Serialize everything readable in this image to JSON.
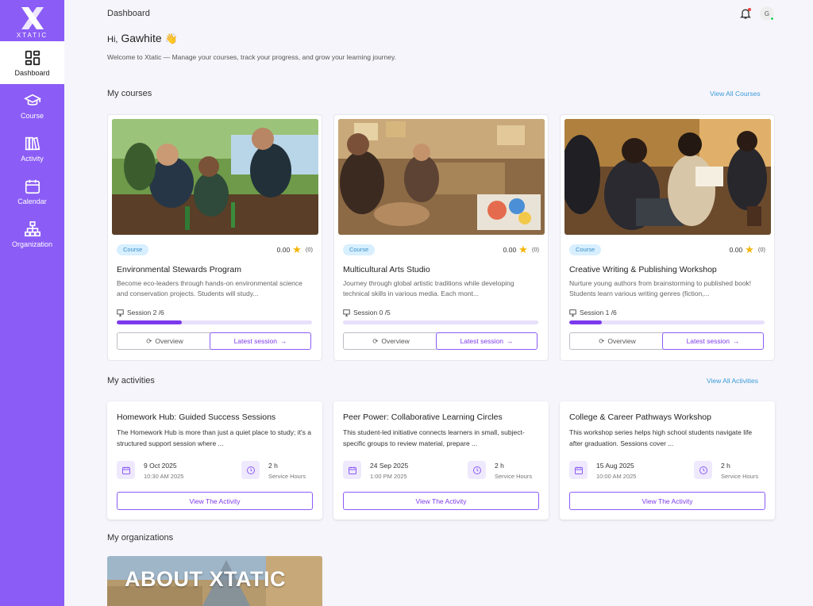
{
  "sidebar": {
    "logo_text": "XTATIC",
    "items": [
      {
        "label": "Dashboard",
        "icon": "dashboard-icon",
        "active": true
      },
      {
        "label": "Course",
        "icon": "graduation-cap-icon",
        "active": false
      },
      {
        "label": "Activity",
        "icon": "books-icon",
        "active": false
      },
      {
        "label": "Calendar",
        "icon": "calendar-icon",
        "active": false
      },
      {
        "label": "Organization",
        "icon": "org-chart-icon",
        "active": false
      }
    ]
  },
  "header": {
    "title": "Dashboard",
    "avatar_initial": "G"
  },
  "greeting": {
    "hi": "Hi,",
    "name": "Gawhite",
    "emoji": "👋",
    "welcome": "Welcome to Xtatic — Manage your courses, track your progress, and grow your learning journey."
  },
  "courses_section": {
    "title": "My courses",
    "view_all": "View All Courses",
    "items": [
      {
        "tag": "Course",
        "rating": "0.00",
        "rating_count": "(0)",
        "name": "Environmental Stewards Program",
        "description": "Become eco-leaders through hands-on environmental science and conservation projects. Students will study...",
        "session": "Session 2 /6",
        "progress": 0.333,
        "overview_label": "Overview",
        "latest_label": "Latest session"
      },
      {
        "tag": "Course",
        "rating": "0.00",
        "rating_count": "(0)",
        "name": "Multicultural Arts Studio",
        "description": "Journey through global artistic traditions while developing technical skills in various media. Each mont...",
        "session": "Session 0 /5",
        "progress": 0,
        "overview_label": "Overview",
        "latest_label": "Latest session"
      },
      {
        "tag": "Course",
        "rating": "0.00",
        "rating_count": "(0)",
        "name": "Creative Writing & Publishing Workshop",
        "description": "Nurture young authors from brainstorming to published book! Students learn various writing genres (fiction,...",
        "session": "Session 1 /6",
        "progress": 0.167,
        "overview_label": "Overview",
        "latest_label": "Latest session"
      }
    ]
  },
  "activities_section": {
    "title": "My activities",
    "view_all": "View All Activities",
    "items": [
      {
        "title": "Homework Hub: Guided Success Sessions",
        "description": "The Homework Hub is more than just a quiet place to study; it's a structured support session where ...",
        "date": "9 Oct 2025",
        "date_sub": "10:30 AM 2025",
        "hours": "2 h",
        "hours_sub": "Service Hours",
        "button": "View The Activity"
      },
      {
        "title": "Peer Power: Collaborative Learning Circles",
        "description": "This student-led initiative connects learners in small, subject-specific groups to review material, prepare ...",
        "date": "24 Sep 2025",
        "date_sub": "1:00 PM 2025",
        "hours": "2 h",
        "hours_sub": "Service Hours",
        "button": "View The Activity"
      },
      {
        "title": "College & Career Pathways Workshop",
        "description": "This workshop series helps high school students navigate life after graduation. Sessions cover ...",
        "date": "15 Aug 2025",
        "date_sub": "10:00 AM 2025",
        "hours": "2 h",
        "hours_sub": "Service Hours",
        "button": "View The Activity"
      }
    ]
  },
  "organizations_section": {
    "title": "My organizations",
    "items": [
      {
        "banner_text": "ABOUT XTATIC"
      }
    ]
  },
  "colors": {
    "accent": "#8b5cf6",
    "accent_dark": "#7c3aed",
    "link": "#3b9bd8",
    "star": "#f4b400"
  }
}
